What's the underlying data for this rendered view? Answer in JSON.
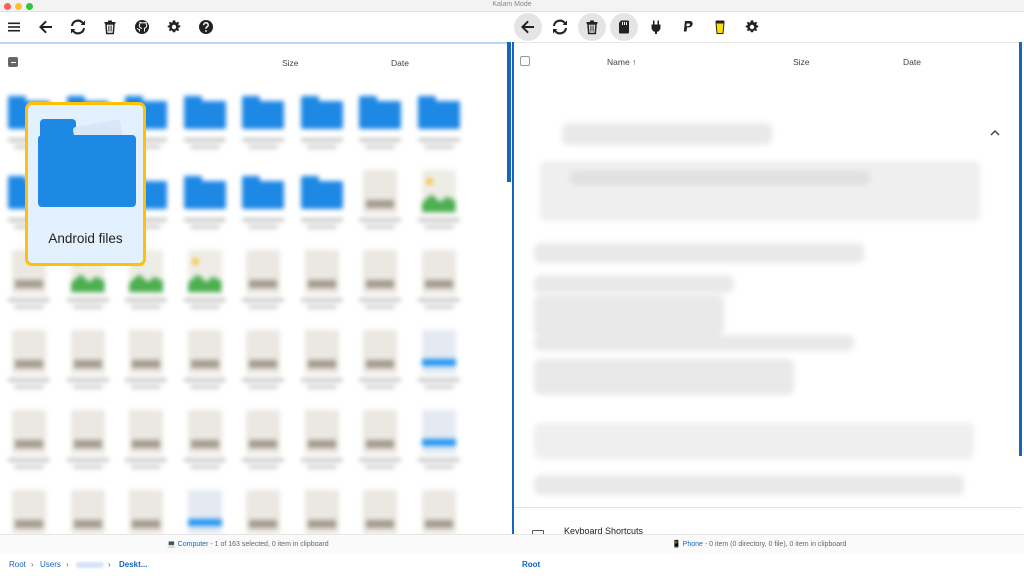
{
  "window": {
    "title": "Kalam Mode"
  },
  "left_toolbar": {
    "icons": [
      "menu-icon",
      "back-arrow-icon",
      "refresh-icon",
      "trash-icon",
      "github-icon",
      "settings-icon",
      "help-icon"
    ]
  },
  "right_toolbar": {
    "icons": [
      "back-arrow-icon",
      "refresh-icon",
      "trash-icon",
      "sd-card-icon",
      "plug-icon",
      "paypal-icon",
      "coffee-cup-icon",
      "settings-icon"
    ]
  },
  "left_pane": {
    "columns": {
      "size": "Size",
      "date": "Date"
    },
    "highlight_label": "Android files"
  },
  "right_pane": {
    "columns": {
      "name": "Name ↑",
      "size": "Size",
      "date": "Date"
    },
    "keyboard_section": "Keyboard Shortcuts"
  },
  "status": {
    "left_link": "Computer",
    "left_text": " - 1 of 163 selected, 0 item in clipboard",
    "right_link": "Phone",
    "right_text": " - 0 item (0 directory, 0 file), 0 item in clipboard"
  },
  "breadcrumbs": {
    "left": [
      "Root",
      "Users",
      "Deskt..."
    ],
    "right": [
      "Root"
    ]
  },
  "colors": {
    "accent": "#1565c0",
    "folder": "#1e88e5",
    "highlight_border": "#ffc107"
  }
}
